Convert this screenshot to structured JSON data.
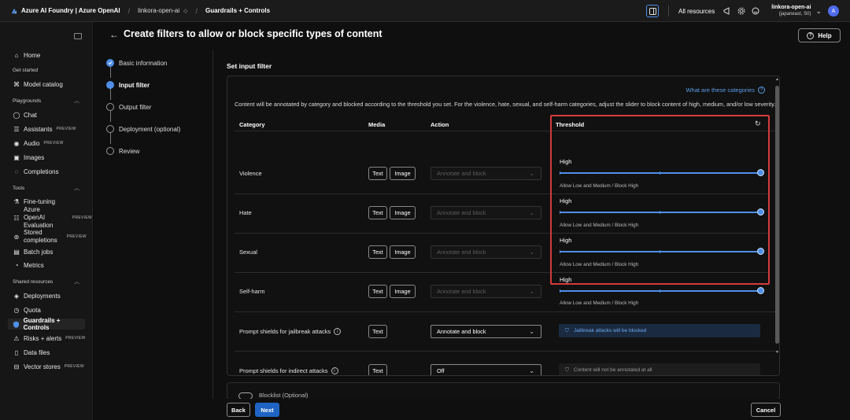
{
  "topbar": {
    "brand": "Azure AI Foundry | Azure OpenAI",
    "project": "linkora-open-ai",
    "page": "Guardrails + Controls",
    "all_resources": "All resources",
    "account_name": "linkora-open-ai",
    "account_region": "(japaneast, S0)",
    "avatar_letter": "A"
  },
  "sidebar": {
    "home": "Home",
    "get_started": "Get started",
    "model_catalog": "Model catalog",
    "playgrounds": "Playgrounds",
    "chat": "Chat",
    "assistants": "Assistants",
    "audio": "Audio",
    "images": "Images",
    "completions": "Completions",
    "tools": "Tools",
    "fine_tuning": "Fine-tuning",
    "aoai_eval_1": "Azure OpenAI",
    "aoai_eval_2": "Evaluation",
    "stored_1": "Stored",
    "stored_2": "completions",
    "batch_jobs": "Batch jobs",
    "metrics": "Metrics",
    "shared_resources": "Shared resources",
    "deployments": "Deployments",
    "quota": "Quota",
    "guardrails": "Guardrails + Controls",
    "risks": "Risks + alerts",
    "data_files": "Data files",
    "vector_stores": "Vector stores",
    "preview": "PREVIEW"
  },
  "page": {
    "title": "Create filters to allow or block specific types of content",
    "help": "Help"
  },
  "steps": [
    "Basic information",
    "Input filter",
    "Output filter",
    "Deployment (optional)",
    "Review"
  ],
  "filter": {
    "section_title": "Set input filter",
    "what_link": "What are these categories",
    "description": "Content will be annotated by category and blocked according to the threshold you set. For the violence, hate, sexual, and self-harm categories, adjust the slider to block content of high, medium, and/or low severity.",
    "headers": {
      "category": "Category",
      "media": "Media",
      "action": "Action",
      "threshold": "Threshold"
    },
    "text_chip": "Text",
    "image_chip": "Image",
    "rows": [
      {
        "category": "Violence",
        "action": "Annotate and block",
        "level": "High",
        "level_value": 1.0,
        "sub": "Allow Low and Medium / Block High"
      },
      {
        "category": "Hate",
        "action": "Annotate and block",
        "level": "High",
        "level_value": 1.0,
        "sub": "Allow Low and Medium / Block High"
      },
      {
        "category": "Sexual",
        "action": "Annotate and block",
        "level": "High",
        "level_value": 1.0,
        "sub": "Allow Low and Medium / Block High"
      },
      {
        "category": "Self-harm",
        "action": "Annotate and block",
        "level": "High",
        "level_value": 1.0,
        "sub": "Allow Low and Medium / Block High"
      }
    ],
    "shields": [
      {
        "category": "Prompt shields for jailbreak attacks",
        "action": "Annotate and block",
        "status": "Jailbreak attacks will be blocked"
      },
      {
        "category": "Prompt shields for indirect attacks",
        "action": "Off",
        "status": "Content will not be annotated at all"
      }
    ],
    "blocklist_label": "Blocklist (Optional)"
  },
  "footer": {
    "back": "Back",
    "next": "Next",
    "cancel": "Cancel"
  }
}
